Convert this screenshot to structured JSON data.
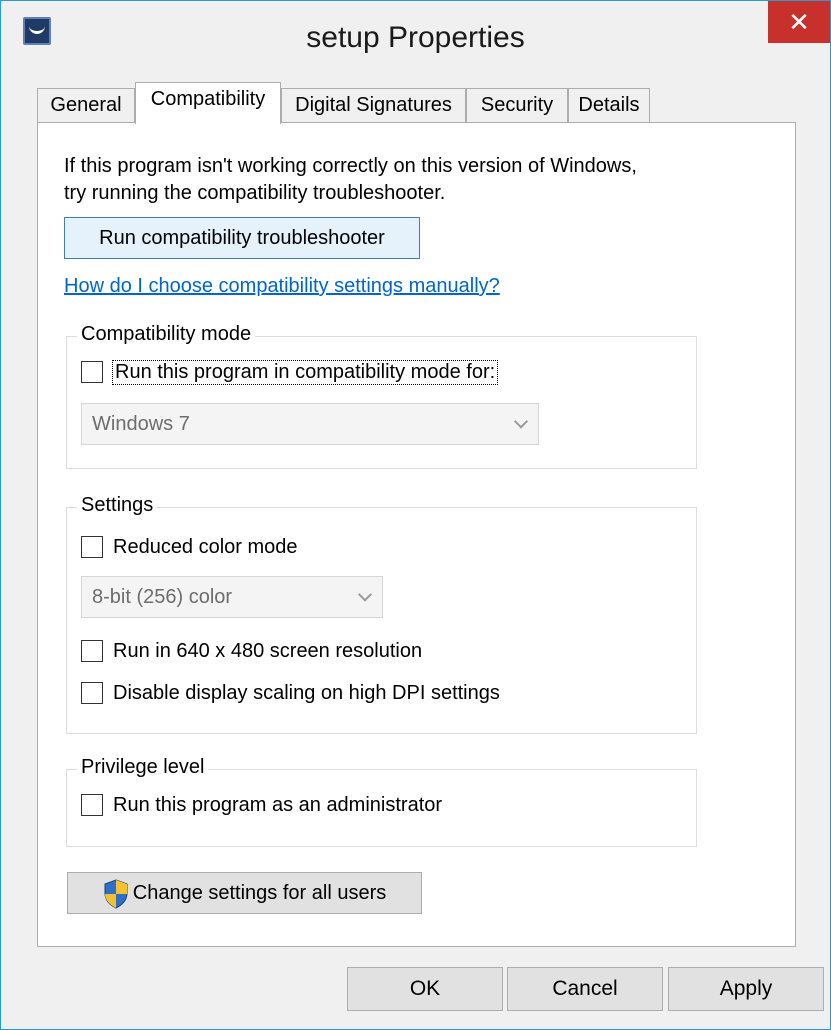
{
  "window": {
    "title": "setup Properties",
    "close_glyph": "✕"
  },
  "tabs": [
    {
      "label": "General",
      "active": false
    },
    {
      "label": "Compatibility",
      "active": true
    },
    {
      "label": "Digital Signatures",
      "active": false
    },
    {
      "label": "Security",
      "active": false
    },
    {
      "label": "Details",
      "active": false
    }
  ],
  "compat": {
    "intro_line1": "If this program isn't working correctly on this version of Windows,",
    "intro_line2": "try running the compatibility troubleshooter.",
    "troubleshooter_button": "Run compatibility troubleshooter",
    "help_link": "How do I choose compatibility settings manually?",
    "mode_group": {
      "title": "Compatibility mode",
      "checkbox_label": "Run this program in compatibility mode for:",
      "select_value": "Windows 7"
    },
    "settings_group": {
      "title": "Settings",
      "reduced_color_label": "Reduced color mode",
      "color_select_value": "8-bit (256) color",
      "resolution_label": "Run in 640 x 480 screen resolution",
      "dpi_label": "Disable display scaling on high DPI settings"
    },
    "privilege_group": {
      "title": "Privilege level",
      "admin_label": "Run this program as an administrator"
    },
    "all_users_button": "Change settings for all users"
  },
  "footer": {
    "ok": "OK",
    "cancel": "Cancel",
    "apply": "Apply"
  },
  "colors": {
    "close_bg": "#c7302b",
    "link": "#0066cc",
    "window_border": "#2b9ad4"
  }
}
